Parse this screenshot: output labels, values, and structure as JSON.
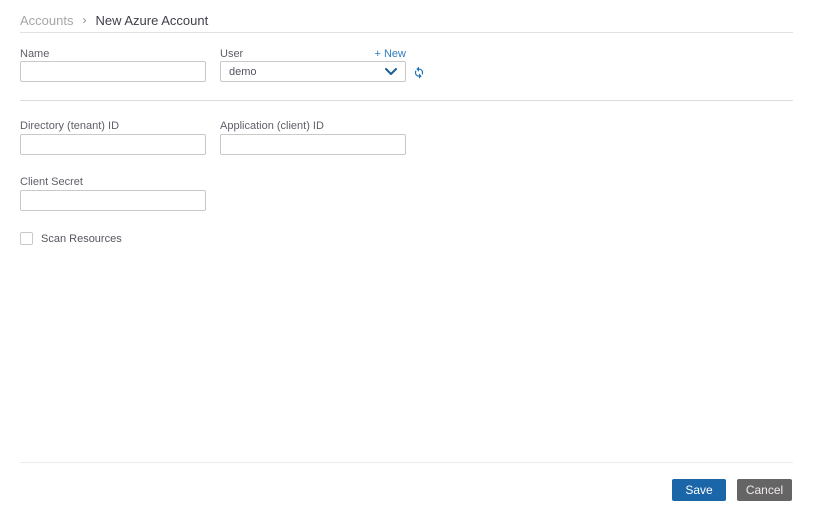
{
  "breadcrumb": {
    "parent": "Accounts",
    "separator": "›",
    "current": "New Azure Account"
  },
  "form": {
    "name": {
      "label": "Name",
      "value": "",
      "placeholder": ""
    },
    "user": {
      "label": "User",
      "value": "demo",
      "new_link": "+ New"
    },
    "directory_id": {
      "label": "Directory (tenant) ID",
      "value": "",
      "placeholder": ""
    },
    "application_id": {
      "label": "Application (client) ID",
      "value": "",
      "placeholder": ""
    },
    "client_secret": {
      "label": "Client Secret",
      "value": "",
      "placeholder": ""
    },
    "scan_resources": {
      "label": "Scan Resources",
      "checked": false
    }
  },
  "footer": {
    "save_label": "Save",
    "cancel_label": "Cancel"
  },
  "icons": {
    "breadcrumb_separator": "chevron-right-icon",
    "user_dropdown": "chevron-down-icon",
    "user_refresh": "refresh-icon"
  },
  "colors": {
    "accent_blue": "#1a66a8",
    "link_blue": "#2f7bbd",
    "icon_blue": "#1d70b7",
    "cancel_gray": "#666565",
    "label_gray": "#5f5f6b",
    "border_gray": "#c9c9c9"
  }
}
